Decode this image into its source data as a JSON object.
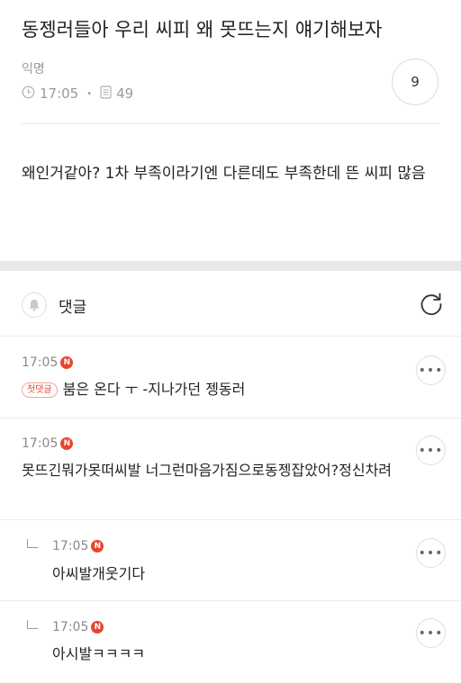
{
  "post": {
    "title": "동젱러들아 우리 씨피 왜 못뜨는지 얘기해보자",
    "author": "익명",
    "time": "17:05",
    "views": "49",
    "comment_count": "9",
    "body": "왜인거같아? 1차 부족이라기엔 다른데도 부족한데 뜬 씨피 많음"
  },
  "comments_section": {
    "label": "댓글"
  },
  "comments": [
    {
      "time": "17:05",
      "badge": "N",
      "first_label": "첫댓글",
      "text": "붐은 온다 ㅜ -지나가던 젱동러"
    },
    {
      "time": "17:05",
      "badge": "N",
      "text": "못뜨긴뭐가못떠씨발 너그런마음가짐으로동젱잡았어?정신차려"
    },
    {
      "time": "17:05",
      "badge": "N",
      "text": "아씨발개웃기다"
    },
    {
      "time": "17:05",
      "badge": "N",
      "text": "아시발ㅋㅋㅋㅋ"
    }
  ],
  "icons": {
    "time": "clock-icon",
    "views": "document-icon",
    "bell": "bell-icon",
    "refresh": "refresh-icon",
    "more": "more-icon"
  },
  "colors": {
    "new_badge": "#e8452e",
    "section_gap": "#e8e8ea"
  }
}
